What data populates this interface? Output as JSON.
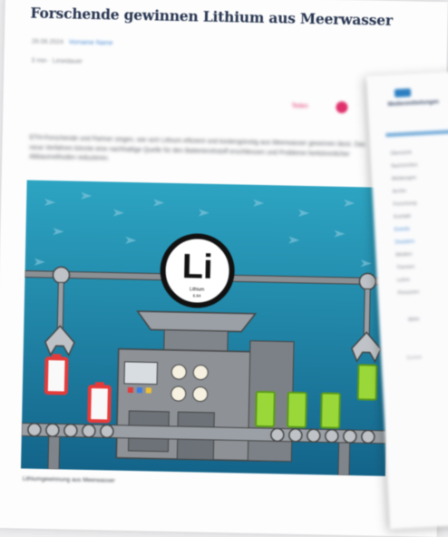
{
  "article": {
    "title": "Forschende gewinnen Lithium aus Meerwasser",
    "date": "28.08.2024",
    "author": "Vorname Name",
    "read_time": "3 min · Lesedauer",
    "share_label": "Teilen",
    "lead": "ETH-Forschende und Partner zeigen, wie sich Lithium effizient und kostengünstig aus Meerwasser gewinnen lässt. Das neue Verfahren könnte eine nachhaltige Quelle für den Batterierohstoff erschliessen und Probleme herkömmlicher Abbaumethoden reduzieren.",
    "caption": "Lithiumgewinnung aus Meerwasser"
  },
  "illustration": {
    "element_symbol": "Li",
    "element_name": "Lithium",
    "element_mass": "6.94",
    "colors": {
      "sea": "#1e85a8",
      "machine": "#8e9297",
      "battery_full": "#9ad83a",
      "battery_empty": "#e53a3a"
    }
  },
  "sidebar": {
    "brand": "Medienmitteilungen",
    "items": [
      "Übersicht",
      "Nachrichten",
      "Meldungen",
      "Archiv",
      "Forschung",
      "Kontakt",
      "Events",
      "Dossiers",
      "Medien",
      "Themen",
      "Lehre",
      "Personen"
    ],
    "more_label": "Mehr",
    "back_label": "Zurück"
  }
}
